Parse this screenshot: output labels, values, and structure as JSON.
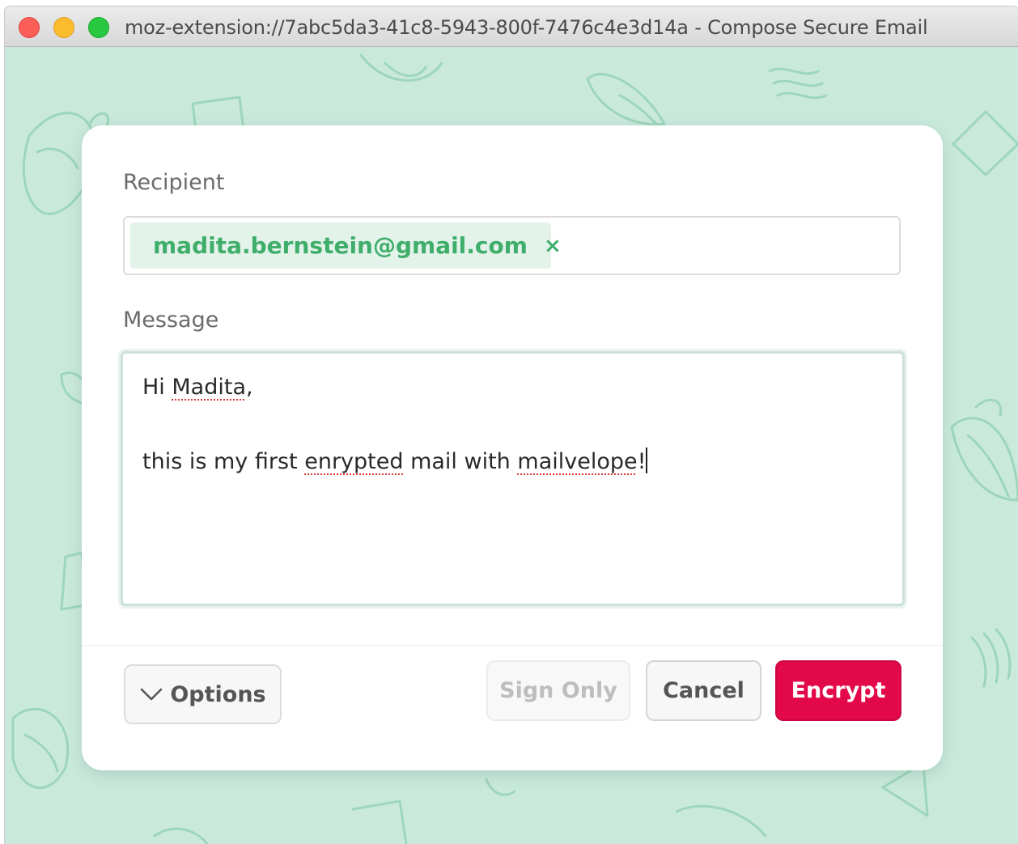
{
  "window": {
    "title": "moz-extension://7abc5da3-41c8-5943-800f-7476c4e3d14a - Compose Secure Email"
  },
  "form": {
    "recipient_label": "Recipient",
    "recipient_email": "madita.bernstein@gmail.com",
    "recipient_remove": "×",
    "message_label": "Message",
    "message": {
      "line1_greeting": "Hi ",
      "line1_name": "Madita",
      "line1_comma": ",",
      "line2_before": "this is my first ",
      "line2_misspelled": "enrypted",
      "line2_middle": " mail with ",
      "line2_brand": "mailvelope",
      "line2_end": "!"
    }
  },
  "footer": {
    "options_label": "Options",
    "sign_only_label": "Sign Only",
    "cancel_label": "Cancel",
    "encrypt_label": "Encrypt"
  },
  "colors": {
    "background": "#c9e9dc",
    "recipient_verified": "#3fae6a",
    "encrypt_button": "#e2084a"
  },
  "icons": {
    "recipient_status": "check-circle-icon",
    "recipient_remove": "close-icon",
    "options": "chevron-down-icon"
  }
}
